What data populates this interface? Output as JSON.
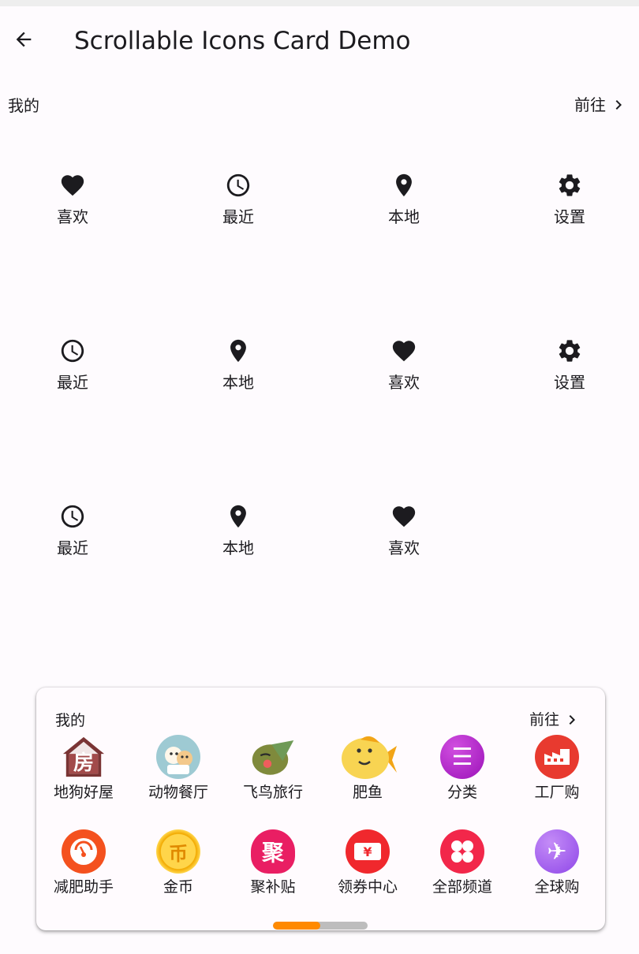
{
  "app_bar": {
    "title": "Scrollable Icons Card Demo"
  },
  "section": {
    "title": "我的",
    "link": "前往"
  },
  "grid_items": [
    {
      "label": "喜欢",
      "icon": "heart-icon"
    },
    {
      "label": "最近",
      "icon": "clock-icon"
    },
    {
      "label": "本地",
      "icon": "location-pin-icon"
    },
    {
      "label": "设置",
      "icon": "gear-icon"
    },
    {
      "label": "最近",
      "icon": "clock-icon"
    },
    {
      "label": "本地",
      "icon": "location-pin-icon"
    },
    {
      "label": "喜欢",
      "icon": "heart-icon"
    },
    {
      "label": "设置",
      "icon": "gear-icon"
    },
    {
      "label": "最近",
      "icon": "clock-icon"
    },
    {
      "label": "本地",
      "icon": "location-pin-icon"
    },
    {
      "label": "喜欢",
      "icon": "heart-icon"
    }
  ],
  "card": {
    "title": "我的",
    "link": "前往",
    "channels": [
      {
        "label": "地狗好屋",
        "icon": "house-icon",
        "glyph": "房",
        "color": "#8b3a3a"
      },
      {
        "label": "动物餐厅",
        "icon": "animal-restaurant-icon",
        "color": "#9ecad3"
      },
      {
        "label": "飞鸟旅行",
        "icon": "bird-icon",
        "color": "#7f8a3c"
      },
      {
        "label": "肥鱼",
        "icon": "fish-icon",
        "color": "#f5c842"
      },
      {
        "label": "分类",
        "icon": "category-icon",
        "glyph": "☰",
        "color": "#b015c9"
      },
      {
        "label": "工厂购",
        "icon": "factory-icon",
        "color": "#e83a2f"
      },
      {
        "label": "减肥助手",
        "icon": "scale-icon",
        "color": "#f4511e"
      },
      {
        "label": "金币",
        "icon": "coin-icon",
        "glyph": "币",
        "color": "#f7b500"
      },
      {
        "label": "聚补贴",
        "icon": "subsidy-icon",
        "glyph": "聚",
        "color": "#e91e63"
      },
      {
        "label": "领券中心",
        "icon": "coupon-icon",
        "glyph": "¥",
        "color": "#f0282d"
      },
      {
        "label": "全部频道",
        "icon": "all-channels-icon",
        "color": "#f2274a"
      },
      {
        "label": "全球购",
        "icon": "plane-icon",
        "glyph": "✈",
        "color": "#a35ef0"
      }
    ],
    "scroll_progress": 0.5
  }
}
